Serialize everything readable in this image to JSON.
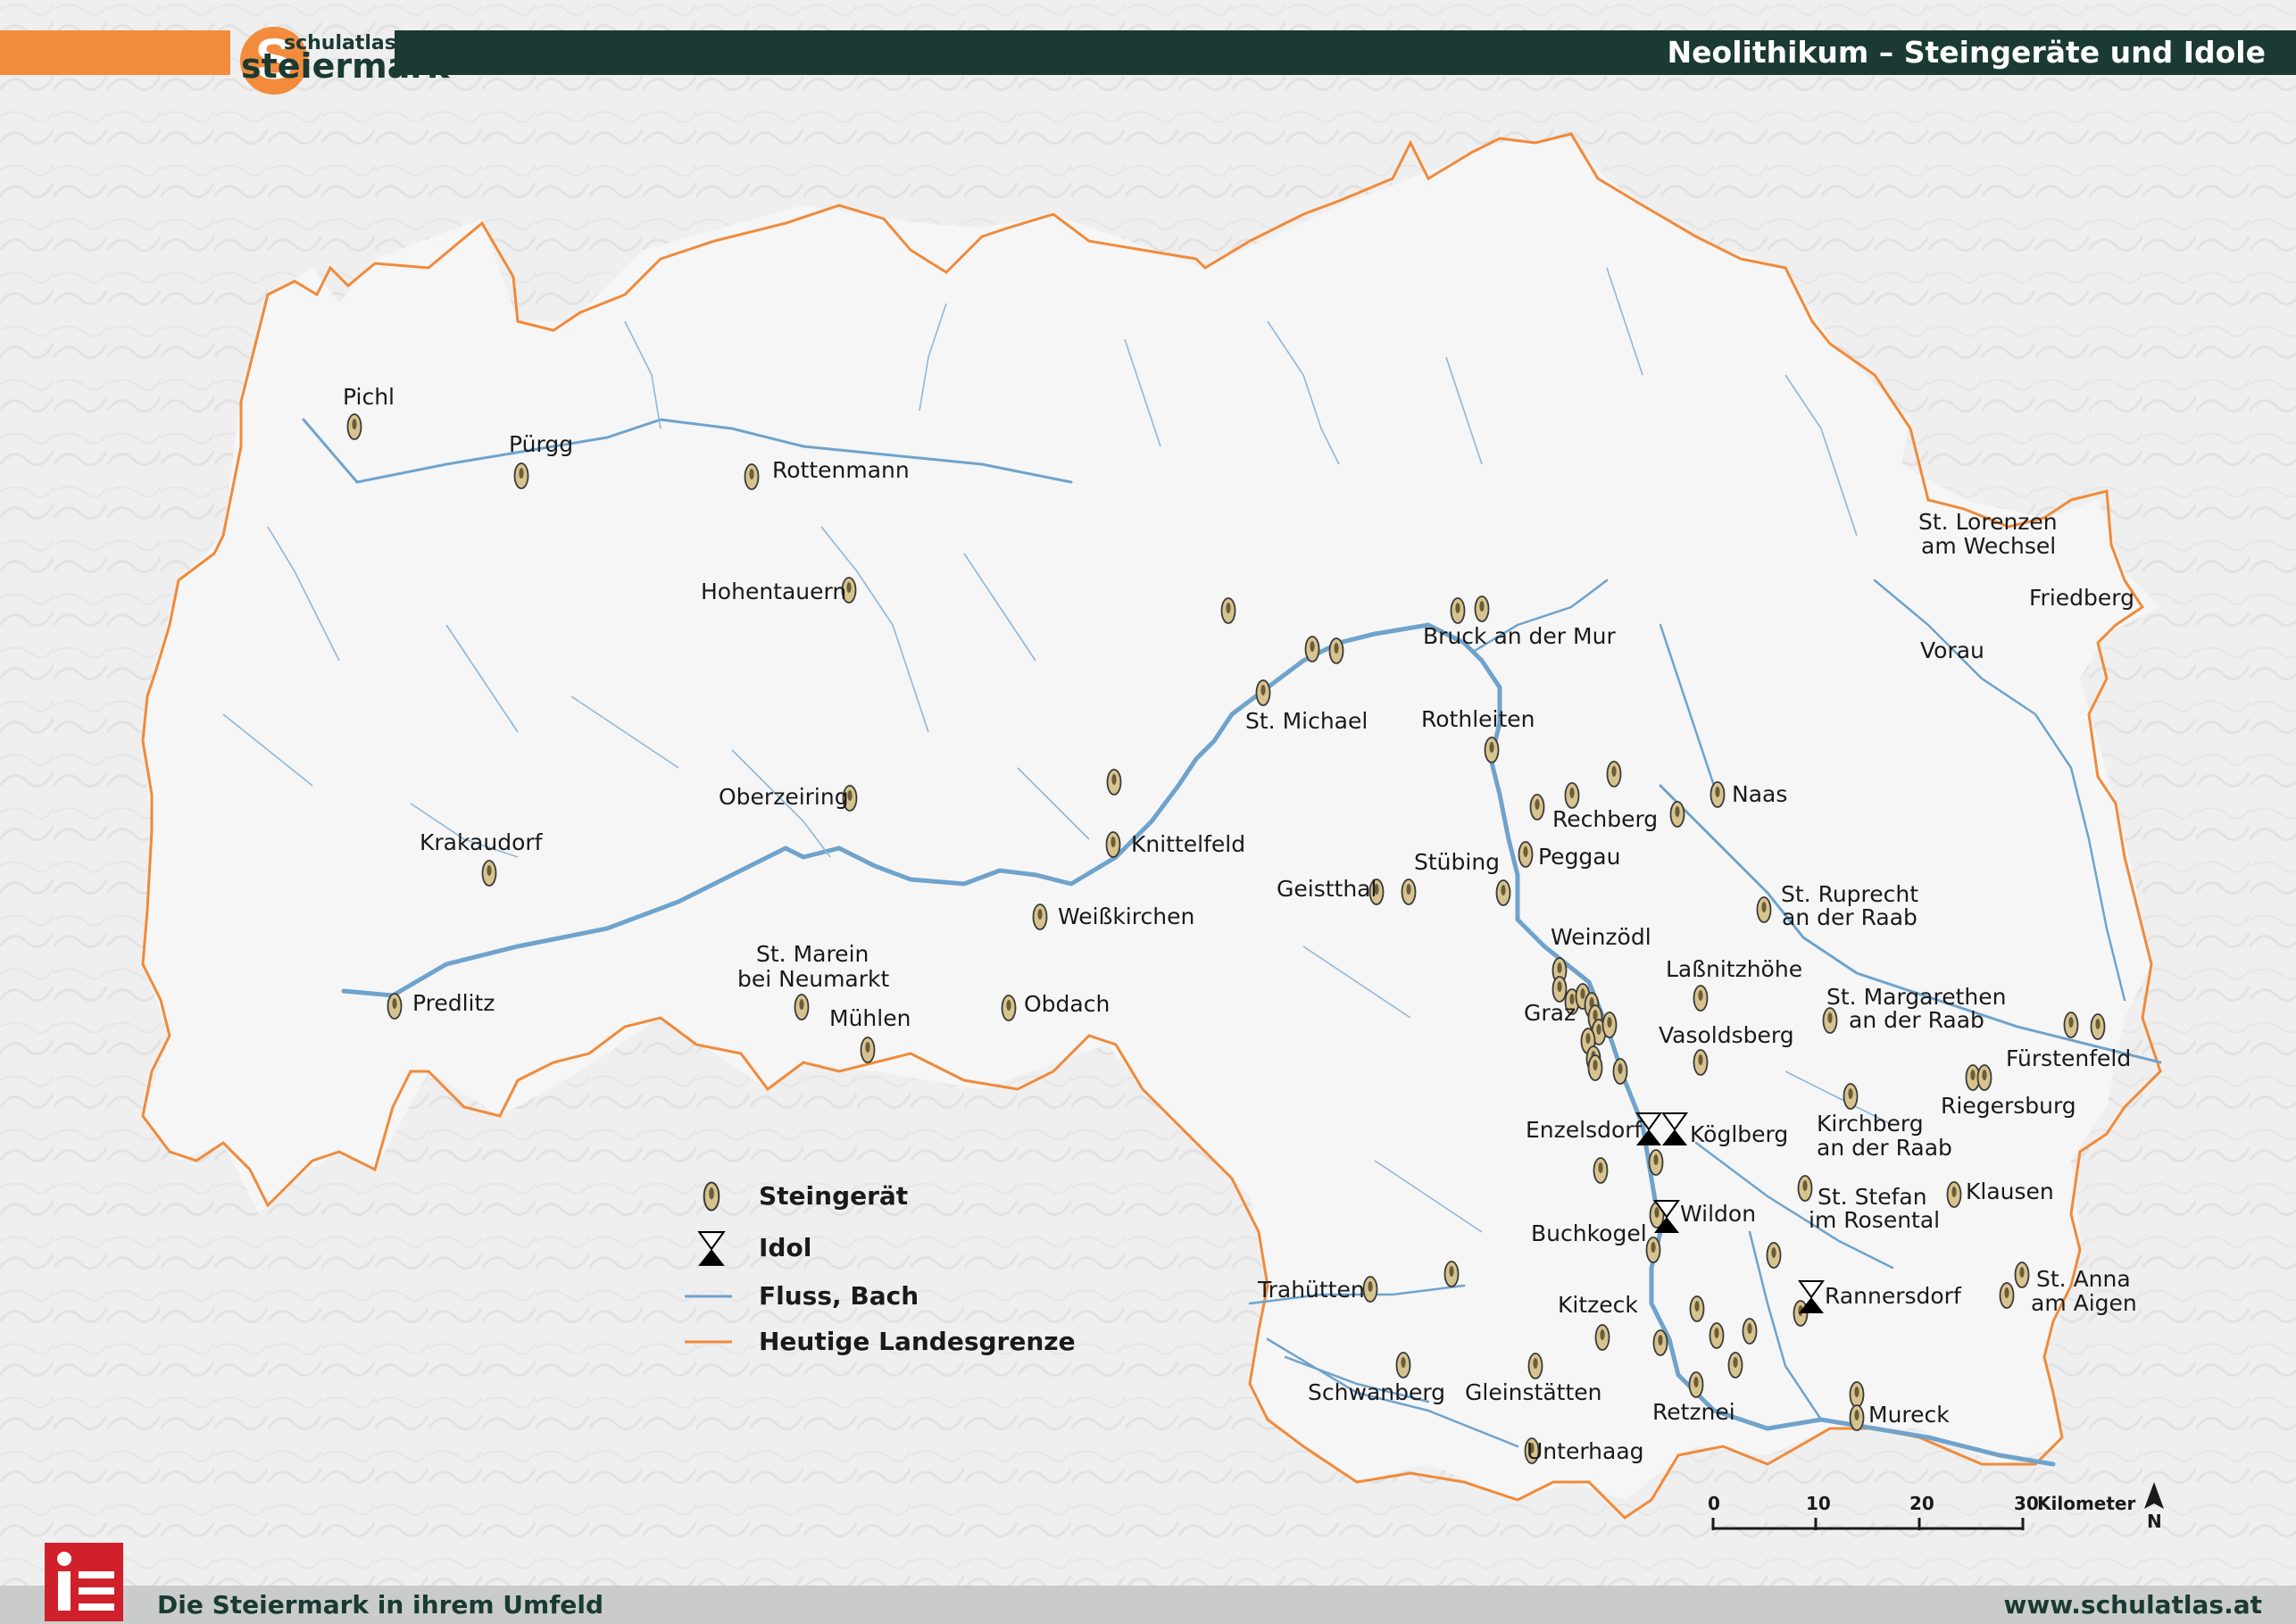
{
  "header": {
    "title": "Neolithikum – Steingeräte und Idole",
    "logo_small": "schulatlas",
    "logo_big": "steiermark",
    "accent_orange": "#f28c3c",
    "dark_green": "#1a3a33"
  },
  "footer": {
    "left": "Die Steiermark in ihrem Umfeld",
    "right": "www.schulatlas.at"
  },
  "legend": {
    "steingeraet": "Steingerät",
    "idol": "Idol",
    "fluss": "Fluss, Bach",
    "grenze": "Heutige Landesgrenze"
  },
  "scalebar": {
    "ticks": [
      "0",
      "10",
      "20",
      "30"
    ],
    "unit": "Kilometer",
    "north": "N"
  },
  "colors": {
    "river": "#6fa3cc",
    "border": "#f08a3a",
    "artifact": "#d6c38e",
    "idol": "#000000"
  },
  "places": [
    "Pichl",
    "Pürgg",
    "Rottenmann",
    "Hohentauern",
    "Oberzeiring",
    "Krakaudorf",
    "Predlitz",
    "St. Marein",
    "bei Neumarkt",
    "Mühlen",
    "Obdach",
    "Weißkirchen",
    "Knittelfeld",
    "St. Michael",
    "Bruck an der Mur",
    "Rothleiten",
    "Rechberg",
    "Naas",
    "Peggau",
    "Stübing",
    "Geistthal",
    "St. Ruprecht",
    "an der Raab",
    "Weinzödl",
    "Laßnitzhöhe",
    "Graz",
    "Vasoldsberg",
    "St. Margarethen",
    "an der Raab",
    "Fürstenfeld",
    "Riegersburg",
    "Kirchberg",
    "an der Raab",
    "Enzelsdorf",
    "Köglberg",
    "St. Stefan",
    "im Rosental",
    "Klausen",
    "Wildon",
    "Buchkogel",
    "Trahütten",
    "Kitzeck",
    "Rannersdorf",
    "St. Anna",
    "am Aigen",
    "Schwanberg",
    "Gleinstätten",
    "Retznei",
    "Mureck",
    "Unterhaag",
    "St. Lorenzen",
    "am Wechsel",
    "Friedberg",
    "Vorau"
  ]
}
